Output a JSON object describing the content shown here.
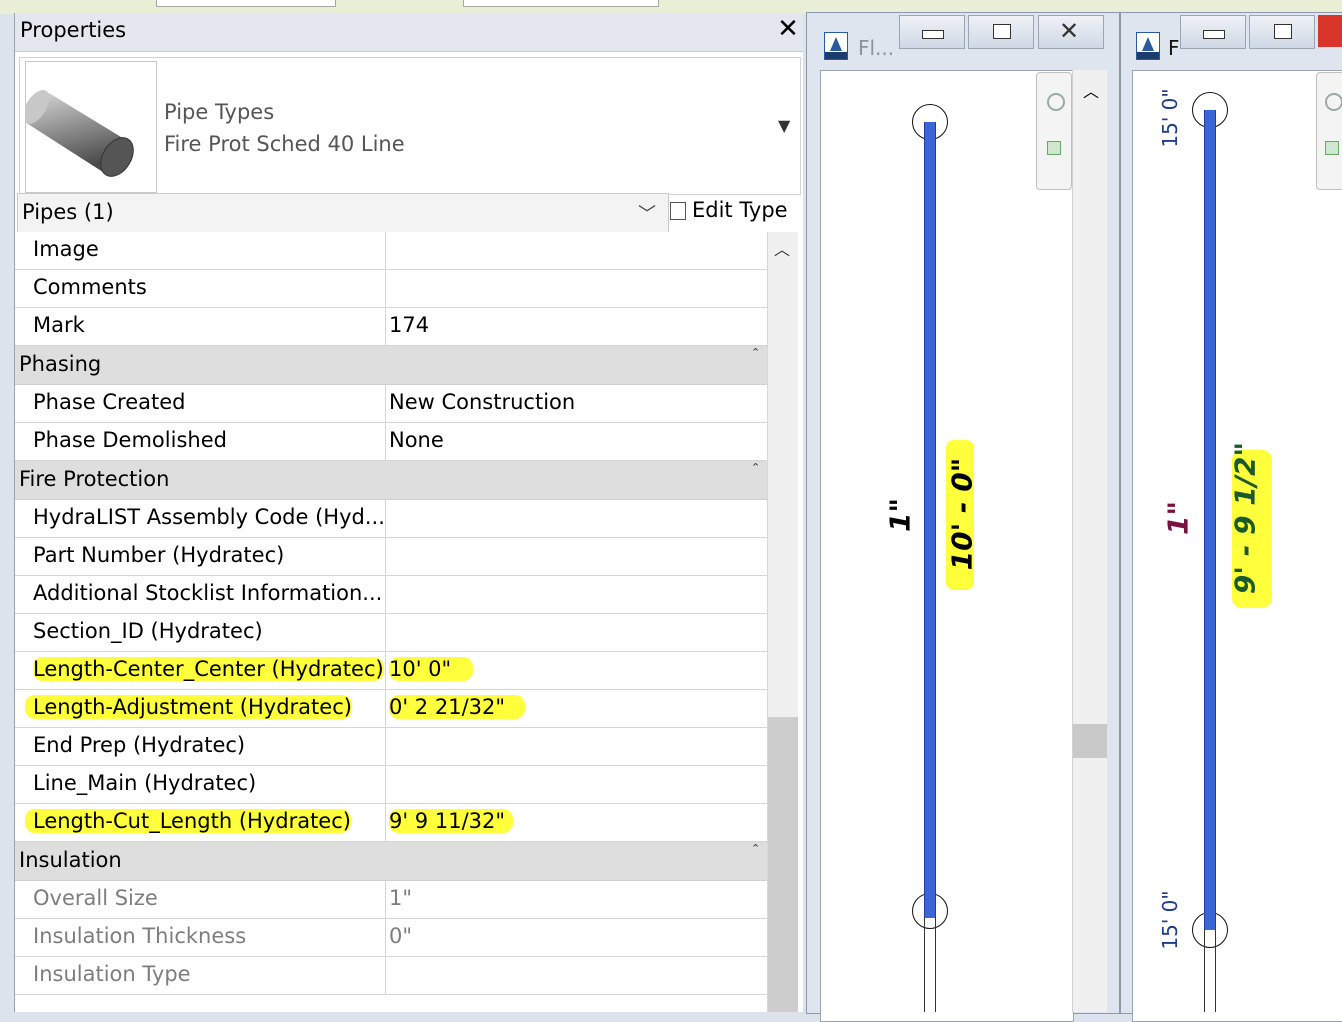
{
  "properties": {
    "title": "Properties",
    "type_family": "Pipe Types",
    "type_name": "Fire Prot Sched 40 Line",
    "selector": "Pipes (1)",
    "edit_type": "Edit Type",
    "rows_identity": [
      {
        "label": "Image",
        "value": ""
      },
      {
        "label": "Comments",
        "value": ""
      },
      {
        "label": "Mark",
        "value": "174"
      }
    ],
    "group_phasing": "Phasing",
    "rows_phasing": [
      {
        "label": "Phase Created",
        "value": "New Construction"
      },
      {
        "label": "Phase Demolished",
        "value": "None"
      }
    ],
    "group_fire": "Fire Protection",
    "rows_fire": [
      {
        "label": "HydraLIST Assembly Code (Hyd...",
        "value": ""
      },
      {
        "label": "Part Number (Hydratec)",
        "value": ""
      },
      {
        "label": "Additional Stocklist Information...",
        "value": ""
      },
      {
        "label": "Section_ID (Hydratec)",
        "value": ""
      },
      {
        "label": "Length-Center_Center (Hydratec)",
        "value": "10'  0\""
      },
      {
        "label": "Length-Adjustment (Hydratec)",
        "value": "0'  2 21/32\""
      },
      {
        "label": "End Prep (Hydratec)",
        "value": ""
      },
      {
        "label": "Line_Main (Hydratec)",
        "value": ""
      },
      {
        "label": "Length-Cut_Length (Hydratec)",
        "value": "9'  9 11/32\""
      }
    ],
    "group_insulation": "Insulation",
    "rows_insulation": [
      {
        "label": "Overall Size",
        "value": "1\""
      },
      {
        "label": "Insulation Thickness",
        "value": "0\""
      },
      {
        "label": "Insulation Type",
        "value": ""
      }
    ]
  },
  "view1": {
    "tab_title": "Fl...",
    "pipe_size": "1\"",
    "length": "10' - 0\""
  },
  "view2": {
    "tab_title": "F",
    "pipe_size": "1\"",
    "length": "9' - 9 1/2\"",
    "elev_top": "15' 0\"",
    "elev_bottom": "15' 0\""
  },
  "icons": {
    "rvt_label": "RVT"
  },
  "colors": {
    "highlight": "#ffff3c",
    "pipe": "#3a66d8",
    "size_label_view2": "#7a1040",
    "dim_label_view2": "#1a5a2a",
    "elev_label": "#1f3c8a"
  }
}
